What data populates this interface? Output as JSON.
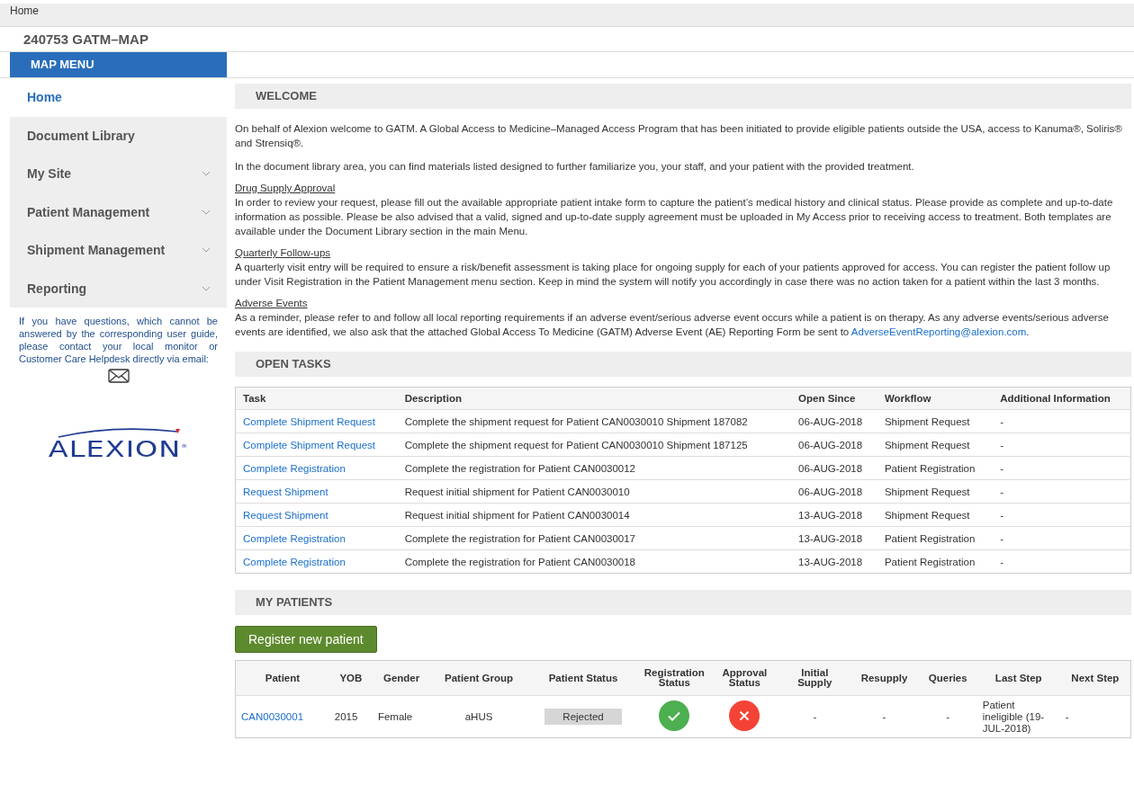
{
  "breadcrumb": "Home",
  "site_title": "240753 GATM–MAP",
  "sidebar": {
    "header": "MAP MENU",
    "items": [
      {
        "label": "Home",
        "selected": true,
        "expandable": false
      },
      {
        "label": "Document Library",
        "selected": false,
        "expandable": false
      },
      {
        "label": "My Site",
        "selected": false,
        "expandable": true
      },
      {
        "label": "Patient Management",
        "selected": false,
        "expandable": true
      },
      {
        "label": "Shipment Management",
        "selected": false,
        "expandable": true
      },
      {
        "label": "Reporting",
        "selected": false,
        "expandable": true
      }
    ],
    "help_text": "If you have questions, which cannot be answered by the corresponding user guide, please contact your local monitor or Customer Care Helpdesk directly via email:",
    "logo": {
      "text": "ALEXION",
      "mark": "®"
    }
  },
  "welcome": {
    "title": "WELCOME",
    "paragraphs": [
      "On behalf of Alexion welcome to GATM. A Global Access to Medicine–Managed Access Program that has been initiated to provide eligible patients outside the USA, access to Kanuma®, Soliris® and Strensiq®.",
      "In the document library area, you can find materials listed designed to further familiarize you, your staff, and your patient with the provided treatment."
    ],
    "sections": [
      {
        "heading": "Drug Supply Approval",
        "text": "In order to review your request, please fill out the available appropriate patient intake form to capture the patient’s medical history and clinical status. Please provide as complete and up-to-date information as possible.  Please be also advised that a valid, signed and up-to-date supply agreement must be uploaded in My Access prior to receiving access to treatment. Both templates are available under the Document Library section in the main Menu."
      },
      {
        "heading": "Quarterly Follow-ups",
        "text": "A quarterly visit entry will be required to ensure a risk/benefit assessment is taking place for ongoing supply for each of your patients approved for access. You can register the patient follow up under Visit Registration in the Patient Management menu section. Keep in mind the system will notify you accordingly in case there was no action taken for a patient within the last 3 months."
      },
      {
        "heading": "Adverse Events",
        "text": "As a reminder, please refer to and follow all local reporting requirements if an adverse event/serious adverse event occurs while a patient is on therapy.  As any adverse events/serious adverse events are identified, we also ask that the attached Global Access To Medicine (GATM) Adverse Event (AE) Reporting Form be sent to",
        "link": "AdverseEventReporting@alexion.com",
        "after": "."
      }
    ]
  },
  "open_tasks": {
    "title": "OPEN TASKS",
    "columns": [
      "Task",
      "Description",
      "Open Since",
      "Workflow",
      "Additional Information"
    ],
    "rows": [
      {
        "task": "Complete Shipment Request",
        "description": "Complete the shipment request for Patient CAN0030010 Shipment 187082",
        "open_since": "06-AUG-2018",
        "workflow": "Shipment Request",
        "info": "-"
      },
      {
        "task": "Complete Shipment Request",
        "description": "Complete the shipment request for Patient CAN0030010 Shipment 187125",
        "open_since": "06-AUG-2018",
        "workflow": "Shipment Request",
        "info": "-"
      },
      {
        "task": "Complete Registration",
        "description": "Complete the registration for Patient CAN0030012",
        "open_since": "06-AUG-2018",
        "workflow": "Patient Registration",
        "info": "-"
      },
      {
        "task": "Request Shipment",
        "description": "Request initial shipment for Patient CAN0030010",
        "open_since": "06-AUG-2018",
        "workflow": "Shipment Request",
        "info": "-"
      },
      {
        "task": "Request Shipment",
        "description": "Request initial shipment for Patient CAN0030014",
        "open_since": "13-AUG-2018",
        "workflow": "Shipment Request",
        "info": "-"
      },
      {
        "task": "Complete Registration",
        "description": "Complete the registration for Patient CAN0030017",
        "open_since": "13-AUG-2018",
        "workflow": "Patient Registration",
        "info": "-"
      },
      {
        "task": "Complete Registration",
        "description": "Complete the registration for Patient CAN0030018",
        "open_since": "13-AUG-2018",
        "workflow": "Patient Registration",
        "info": "-"
      }
    ]
  },
  "my_patients": {
    "title": "MY PATIENTS",
    "register_button": "Register new patient",
    "columns": [
      "Patient",
      "YOB",
      "Gender",
      "Patient Group",
      "Patient Status",
      "Registration Status",
      "Approval Status",
      "Initial Supply",
      "Resupply",
      "Queries",
      "Last Step",
      "Next Step"
    ],
    "rows": [
      {
        "patient": "CAN0030001",
        "yob": "2015",
        "gender": "Female",
        "group": "aHUS",
        "status": "Rejected",
        "registered": true,
        "approved": false,
        "initial_supply": "-",
        "resupply": "-",
        "queries": "-",
        "last_step": "Patient ineligible (19-JUL-2018)",
        "next_step": "-"
      }
    ]
  }
}
